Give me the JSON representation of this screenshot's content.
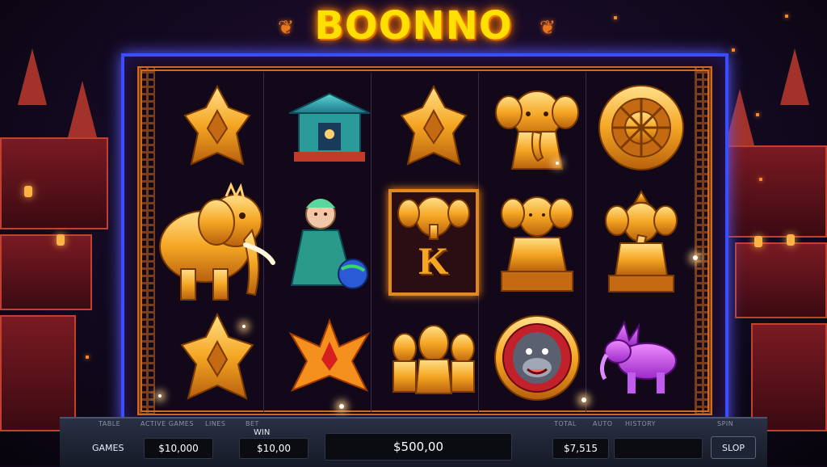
{
  "game": {
    "title": "BOONNO",
    "title_ornament": "❦"
  },
  "reels": [
    [
      "diamond-shield",
      "temple-shrine",
      "diamond-shield",
      "golden-elephant",
      "golden-chakra-wheel"
    ],
    [
      "golden-elephant-large",
      "goddess-with-orb",
      "letter-k-elephant",
      "golden-buddha-statue",
      "ganesha-statue"
    ],
    [
      "diamond-shield",
      "orange-star",
      "twin-elephant-ganesha",
      "monkey-medallion",
      "purple-dragon-elephant"
    ]
  ],
  "symbol_text": {
    "k_letter": "K"
  },
  "controls": {
    "tiny_labels": [
      "TABLE",
      "ACTIVE GAMES",
      "LINES",
      "BET",
      "TOTAL",
      "AUTO",
      "HISTORY",
      "SPIN"
    ],
    "games_label": "GAMES",
    "balance_value": "$10,000",
    "win_label": "WIN",
    "win_value": "$10,00",
    "jackpot_value": "$500,00",
    "bet_value": "$7,515",
    "autoplay_value": "",
    "slop_button": "SLOP"
  },
  "colors": {
    "title": "#ffe000",
    "frame_border": "#3c4cff",
    "gold": "#f5a623",
    "accent_orange": "#d06a1e"
  }
}
